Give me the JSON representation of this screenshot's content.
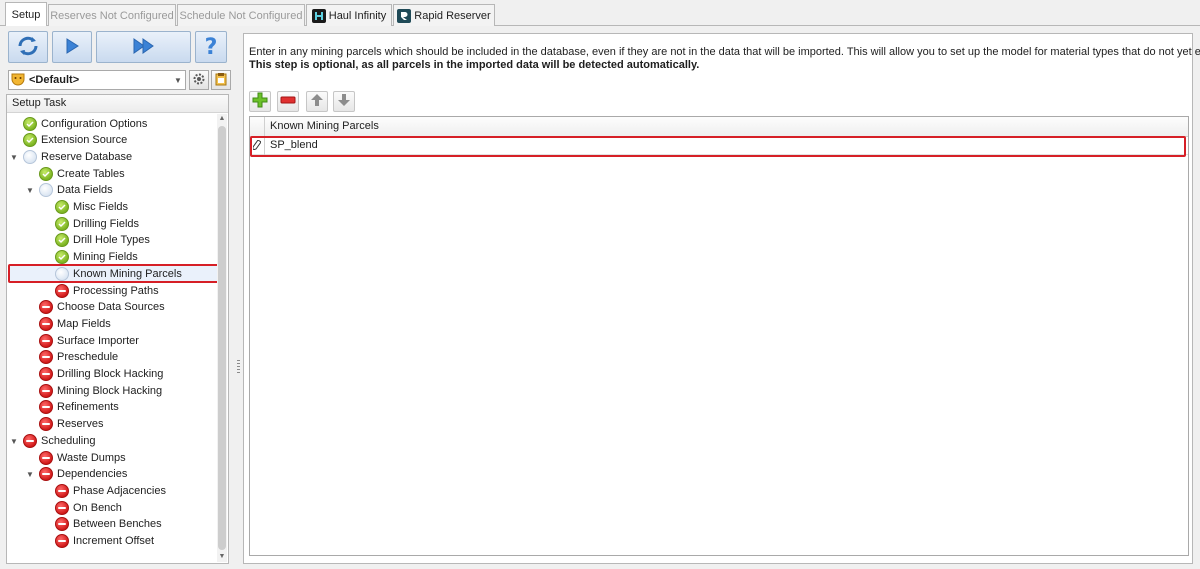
{
  "tabs": [
    {
      "label": "Setup",
      "state": "active"
    },
    {
      "label": "Reserves Not Configured",
      "state": "disabled"
    },
    {
      "label": "Schedule Not Configured",
      "state": "disabled"
    },
    {
      "label": "Haul Infinity",
      "state": "enabled",
      "icon": "haul-infinity-icon"
    },
    {
      "label": "Rapid Reserver",
      "state": "enabled",
      "icon": "rapid-reserver-icon"
    }
  ],
  "toolbar": {
    "buttons": [
      "refresh-icon",
      "play-icon",
      "fast-forward-icon",
      "help-icon"
    ]
  },
  "profile": {
    "value": "<Default>"
  },
  "tree": {
    "header": "Setup Task",
    "items": [
      {
        "label": "Configuration Options",
        "status": "done",
        "level": 0
      },
      {
        "label": "Extension Source",
        "status": "done",
        "level": 0
      },
      {
        "label": "Reserve Database",
        "status": "pending",
        "level": 0,
        "expanded": true
      },
      {
        "label": "Create Tables",
        "status": "done",
        "level": 1
      },
      {
        "label": "Data Fields",
        "status": "pending",
        "level": 1,
        "expanded": true
      },
      {
        "label": "Misc Fields",
        "status": "done",
        "level": 2
      },
      {
        "label": "Drilling Fields",
        "status": "done",
        "level": 2
      },
      {
        "label": "Drill Hole Types",
        "status": "done",
        "level": 2
      },
      {
        "label": "Mining Fields",
        "status": "done",
        "level": 2
      },
      {
        "label": "Known Mining Parcels",
        "status": "pending",
        "level": 2,
        "selected": true
      },
      {
        "label": "Processing Paths",
        "status": "blocked",
        "level": 2
      },
      {
        "label": "Choose Data Sources",
        "status": "blocked",
        "level": 1
      },
      {
        "label": "Map Fields",
        "status": "blocked",
        "level": 1
      },
      {
        "label": "Surface Importer",
        "status": "blocked",
        "level": 1
      },
      {
        "label": "Preschedule",
        "status": "blocked",
        "level": 1
      },
      {
        "label": "Drilling Block Hacking",
        "status": "blocked",
        "level": 1
      },
      {
        "label": "Mining Block Hacking",
        "status": "blocked",
        "level": 1
      },
      {
        "label": "Refinements",
        "status": "blocked",
        "level": 1
      },
      {
        "label": "Reserves",
        "status": "blocked",
        "level": 1
      },
      {
        "label": "Scheduling",
        "status": "blocked",
        "level": 0,
        "expanded": true
      },
      {
        "label": "Waste Dumps",
        "status": "blocked",
        "level": 1
      },
      {
        "label": "Dependencies",
        "status": "blocked",
        "level": 1,
        "expanded": true
      },
      {
        "label": "Phase Adjacencies",
        "status": "blocked",
        "level": 2
      },
      {
        "label": "On Bench",
        "status": "blocked",
        "level": 2
      },
      {
        "label": "Between Benches",
        "status": "blocked",
        "level": 2
      },
      {
        "label": "Increment Offset",
        "status": "blocked",
        "level": 2
      }
    ]
  },
  "content": {
    "description": "Enter in any mining parcels which should be included in the database, even if they are not in the data that will be imported. This will allow you to set up the model for material types that do not yet exist.",
    "note": "This step is optional, as all parcels in the imported data will be detected automatically.",
    "grid_buttons": [
      "add-icon",
      "remove-icon",
      "move-up-icon",
      "move-down-icon"
    ],
    "grid": {
      "column": "Known Mining Parcels",
      "rows": [
        "SP_blend"
      ]
    }
  },
  "colors": {
    "done": "#7cb422",
    "blocked": "#cf1515",
    "highlight": "#d61f26"
  }
}
